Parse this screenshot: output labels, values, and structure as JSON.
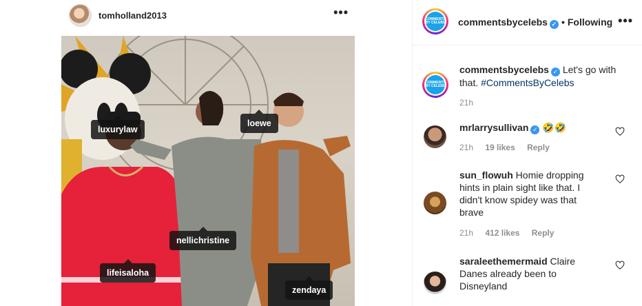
{
  "post": {
    "username": "tomholland2013",
    "more": "•••",
    "tags": [
      "luxurylaw",
      "loewe",
      "nellichristine",
      "lifeisaloha",
      "zendaya"
    ]
  },
  "sidebar": {
    "header": {
      "username": "commentsbycelebs",
      "dot": "•",
      "following": "Following",
      "more": "•••"
    },
    "caption": {
      "username": "commentsbycelebs",
      "text": "Let's go with that.",
      "hashtag": "#CommentsByCelebs",
      "time": "21h"
    },
    "comments": [
      {
        "username": "mrlarrysullivan",
        "text": "🤣🤣",
        "verified": true,
        "time": "21h",
        "likes": "19 likes",
        "reply": "Reply"
      },
      {
        "username": "sun_flowuh",
        "text": "Homie dropping hints in plain sight like that. I didn't know spidey was that brave",
        "verified": false,
        "time": "21h",
        "likes": "412 likes",
        "reply": "Reply"
      },
      {
        "username": "saraleethemermaid",
        "text": "Claire Danes already been to Disneyland",
        "verified": false,
        "time": "",
        "likes": "",
        "reply": ""
      }
    ],
    "logo_text": "COMMENTS BY CELEBS",
    "verified_mark": "✓"
  }
}
